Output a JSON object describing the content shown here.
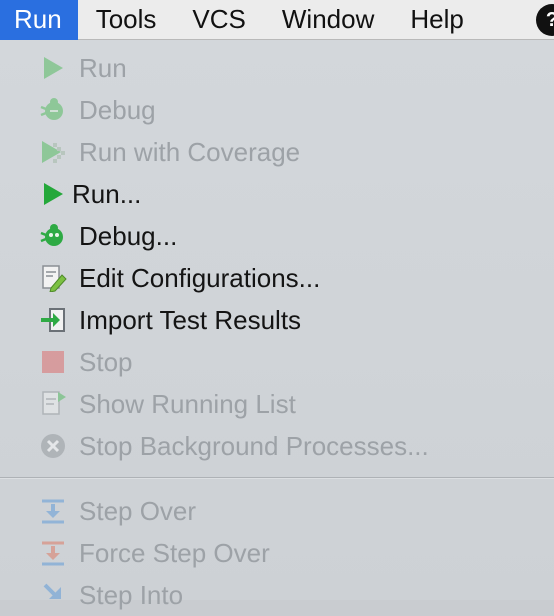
{
  "menubar": {
    "items": [
      {
        "label": "Run",
        "active": true
      },
      {
        "label": "Tools"
      },
      {
        "label": "VCS"
      },
      {
        "label": "Window"
      },
      {
        "label": "Help"
      }
    ]
  },
  "run_menu": {
    "items": [
      {
        "label": "Run",
        "icon": "run-icon",
        "enabled": false
      },
      {
        "label": "Debug",
        "icon": "debug-icon",
        "enabled": false
      },
      {
        "label": "Run with Coverage",
        "icon": "coverage-icon",
        "enabled": false
      },
      {
        "label": "Run...",
        "icon": "run-icon",
        "enabled": true
      },
      {
        "label": "Debug...",
        "icon": "debug-icon",
        "enabled": true
      },
      {
        "label": "Edit Configurations...",
        "icon": "edit-configurations-icon",
        "enabled": true
      },
      {
        "label": "Import Test Results",
        "icon": "import-icon",
        "enabled": true
      },
      {
        "label": "Stop",
        "icon": "stop-icon",
        "enabled": false
      },
      {
        "label": "Show Running List",
        "icon": "running-list-icon",
        "enabled": false
      },
      {
        "label": "Stop Background Processes...",
        "icon": "stop-background-icon",
        "enabled": false
      },
      {
        "label": "Step Over",
        "icon": "step-over-icon",
        "enabled": false
      },
      {
        "label": "Force Step Over",
        "icon": "force-step-over-icon",
        "enabled": false
      },
      {
        "label": "Step Into",
        "icon": "step-into-icon",
        "enabled": false
      }
    ]
  },
  "colors": {
    "accent": "#2a6fe0",
    "run_green": "#3db54a",
    "stop_red": "#e05a5a",
    "step_blue": "#4a90d9",
    "step_red": "#e06a4e"
  }
}
